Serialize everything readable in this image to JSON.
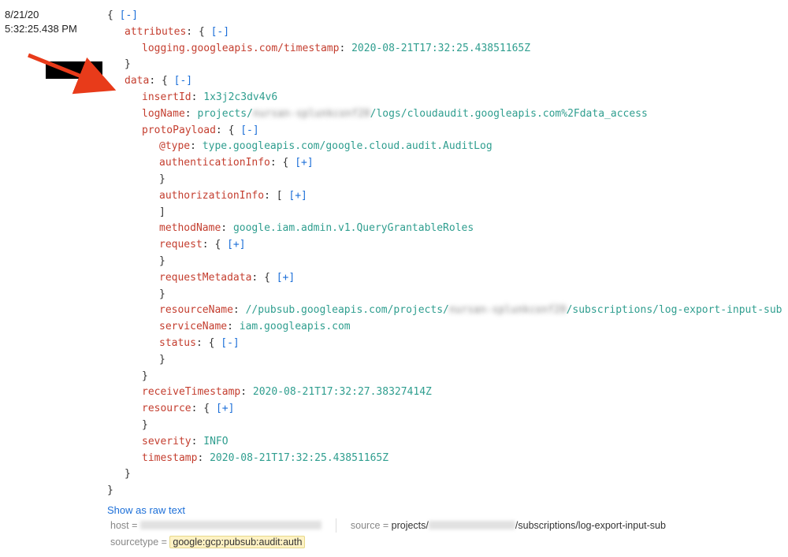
{
  "date": "8/21/20",
  "time": "5:32:25.438 PM",
  "punct": {
    "open": "{",
    "close": "}",
    "bopen": "[",
    "bclose": "]",
    "colon": ": "
  },
  "tog": {
    "minus": "[-]",
    "plus": "[+]"
  },
  "keys": {
    "attributes": "attributes",
    "ts": "logging.googleapis.com/timestamp",
    "data": "data",
    "insertId": "insertId",
    "logName": "logName",
    "protoPayload": "protoPayload",
    "atType": "@type",
    "authenticationInfo": "authenticationInfo",
    "authorizationInfo": "authorizationInfo",
    "methodName": "methodName",
    "request": "request",
    "requestMetadata": "requestMetadata",
    "resourceName": "resourceName",
    "serviceName": "serviceName",
    "status": "status",
    "receiveTimestamp": "receiveTimestamp",
    "resource": "resource",
    "severity": "severity",
    "timestamp": "timestamp"
  },
  "vals": {
    "ts": "2020-08-21T17:32:25.43851165Z",
    "insertId": "1x3j2c3dv4v6",
    "logName_pre": "projects/",
    "logName_blur": "nursan-splunkconf20",
    "logName_post": "/logs/cloudaudit.googleapis.com%2Fdata_access",
    "atType": "type.googleapis.com/google.cloud.audit.AuditLog",
    "methodName": "google.iam.admin.v1.QueryGrantableRoles",
    "resourceName_pre": "//pubsub.googleapis.com/projects/",
    "resourceName_blur": "nursan-splunkconf20",
    "resourceName_post": "/subscriptions/log-export-input-sub",
    "serviceName": "iam.googleapis.com",
    "receiveTimestamp": "2020-08-21T17:32:27.38327414Z",
    "severity": "INFO",
    "timestamp": "2020-08-21T17:32:25.43851165Z"
  },
  "showRaw": "Show as raw text",
  "meta": {
    "hostLabel": "host = ",
    "sourceLabel": "source = ",
    "sourcePre": "projects/",
    "sourcePost": "/subscriptions/log-export-input-sub",
    "sourcetypeLabel": "sourcetype = ",
    "sourcetype": "google:gcp:pubsub:audit:auth"
  }
}
